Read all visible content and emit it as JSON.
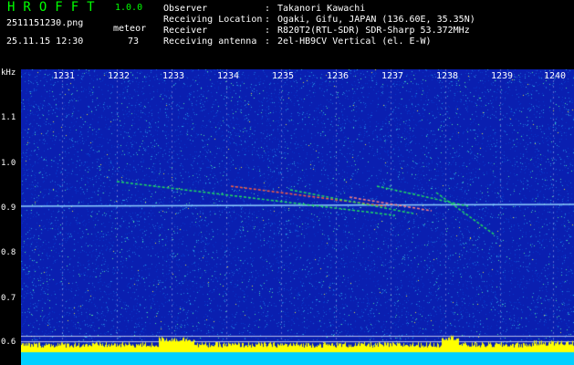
{
  "header": {
    "title": "HROFFT",
    "version": "1.0.0",
    "filename": "2511151230.png",
    "timestamp": "25.11.15 12:30",
    "meteor_label": "meteor",
    "meteor_count": "73",
    "info": [
      {
        "key": "Observer",
        "value": "Takanori Kawachi"
      },
      {
        "key": "Receiving Location",
        "value": "Ogaki, Gifu, JAPAN (136.60E, 35.35N)"
      },
      {
        "key": "Receiver",
        "value": "R820T2(RTL-SDR) SDR-Sharp 53.372MHz"
      },
      {
        "key": "Receiving antenna",
        "value": "2el-HB9CV Vertical (el. E-W)"
      }
    ]
  },
  "spectrogram": {
    "y_unit": "kHz",
    "x_ticks": [
      "1231",
      "1232",
      "1233",
      "1234",
      "1235",
      "1236",
      "1237",
      "1238",
      "1239",
      "1240"
    ],
    "y_ticks": [
      "1.1",
      "1.0",
      "0.9",
      "0.8",
      "0.7",
      "0.6"
    ],
    "colors": {
      "background": "#0a1fb0",
      "carrier": "#8fd0ff",
      "echo": "#20e060",
      "baseline": "#ffff00"
    }
  }
}
